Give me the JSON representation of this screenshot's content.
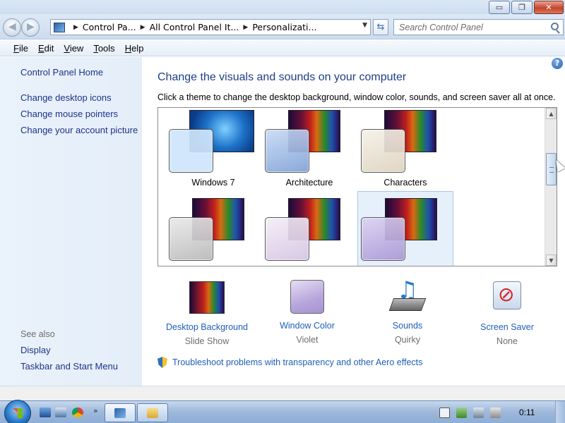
{
  "window": {
    "controls": {
      "minimize": "▭",
      "maximize": "❐",
      "close": "✕"
    }
  },
  "navbar": {
    "breadcrumbs": [
      "Control Pa...",
      "All Control Panel It...",
      "Personalizati..."
    ],
    "search_placeholder": "Search Control Panel"
  },
  "menubar": {
    "items": [
      "File",
      "Edit",
      "View",
      "Tools",
      "Help"
    ]
  },
  "sidebar": {
    "home": "Control Panel Home",
    "links": [
      "Change desktop icons",
      "Change mouse pointers",
      "Change your account picture"
    ],
    "see_also_label": "See also",
    "see_also": [
      "Display",
      "Taskbar and Start Menu"
    ]
  },
  "main": {
    "title": "Change the visuals and sounds on your computer",
    "subtitle": "Click a theme to change the desktop background, window color, sounds, and screen saver all at once.",
    "themes": [
      {
        "label": "Windows 7",
        "front_color": "#cfe6fb",
        "selected": false
      },
      {
        "label": "Architecture",
        "front_color": "#a9c4ea",
        "selected": false
      },
      {
        "label": "Characters",
        "front_color": "#efe9dc",
        "selected": false
      },
      {
        "label": "",
        "front_color": "#cdcdcd",
        "selected": false
      },
      {
        "label": "",
        "front_color": "#e8dced",
        "selected": false
      },
      {
        "label": "",
        "front_color": "#c6b6e2",
        "selected": true
      }
    ],
    "settings": [
      {
        "name": "Desktop Background",
        "value": "Slide Show"
      },
      {
        "name": "Window Color",
        "value": "Violet"
      },
      {
        "name": "Sounds",
        "value": "Quirky"
      },
      {
        "name": "Screen Saver",
        "value": "None"
      }
    ],
    "troubleshoot": "Troubleshoot problems with transparency and other Aero effects"
  },
  "taskbar": {
    "clock": "0:11"
  },
  "colors": {
    "link": "#1e5fb8",
    "title": "#1e3f86",
    "sidebar_bg": "#e4eef9"
  }
}
